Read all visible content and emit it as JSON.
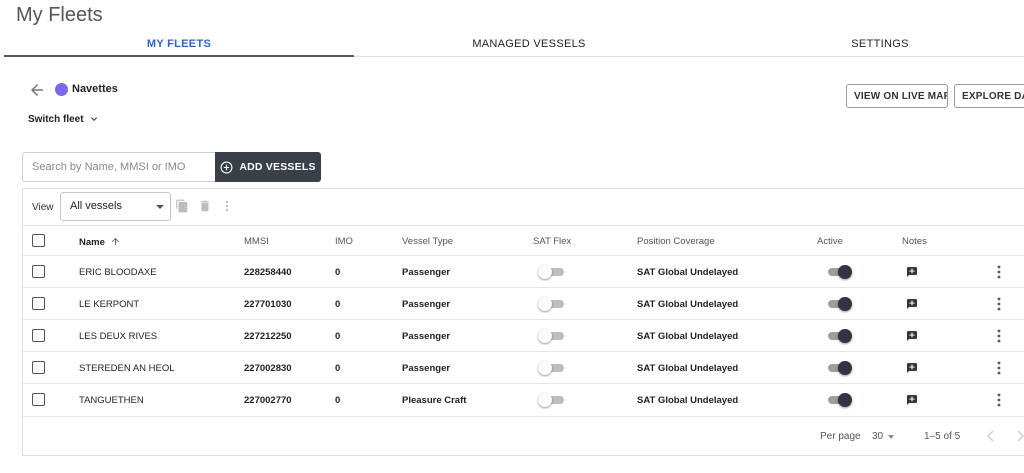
{
  "page_title": "My Fleets",
  "tabs": [
    {
      "label": "MY FLEETS",
      "active": true
    },
    {
      "label": "MANAGED VESSELS",
      "active": false
    },
    {
      "label": "SETTINGS",
      "active": false
    }
  ],
  "fleet": {
    "name": "Navettes",
    "color": "#7b68ee",
    "switch_label": "Switch fleet"
  },
  "actions": {
    "view_on_live_map": "VIEW ON LIVE MAP",
    "explore_data": "EXPLORE DATA"
  },
  "search": {
    "placeholder": "Search by Name, MMSI or IMO",
    "value": ""
  },
  "add_vessels_label": "ADD VESSELS",
  "toolbar": {
    "view_label": "View",
    "view_selected": "All vessels"
  },
  "table": {
    "columns": {
      "name": "Name",
      "mmsi": "MMSI",
      "imo": "IMO",
      "vessel_type": "Vessel Type",
      "sat_flex": "SAT Flex",
      "position_coverage": "Position Coverage",
      "active": "Active",
      "notes": "Notes"
    },
    "rows": [
      {
        "name": "ERIC BLOODAXE",
        "mmsi": "228258440",
        "imo": "0",
        "vessel_type": "Passenger",
        "sat_flex": false,
        "position_coverage": "SAT Global Undelayed",
        "active": true
      },
      {
        "name": "LE KERPONT",
        "mmsi": "227701030",
        "imo": "0",
        "vessel_type": "Passenger",
        "sat_flex": false,
        "position_coverage": "SAT Global Undelayed",
        "active": true
      },
      {
        "name": "LES DEUX RIVES",
        "mmsi": "227212250",
        "imo": "0",
        "vessel_type": "Passenger",
        "sat_flex": false,
        "position_coverage": "SAT Global Undelayed",
        "active": true
      },
      {
        "name": "STEREDEN AN HEOL",
        "mmsi": "227002830",
        "imo": "0",
        "vessel_type": "Passenger",
        "sat_flex": false,
        "position_coverage": "SAT Global Undelayed",
        "active": true
      },
      {
        "name": "TANGUETHEN",
        "mmsi": "227002770",
        "imo": "0",
        "vessel_type": "Pleasure Craft",
        "sat_flex": false,
        "position_coverage": "SAT Global Undelayed",
        "active": true
      }
    ]
  },
  "pagination": {
    "per_page_label": "Per page",
    "per_page_value": "30",
    "range": "1–5 of 5"
  },
  "icons": {
    "back": "arrow-left-icon",
    "switch": "chevron-down-icon",
    "add": "plus-circle-icon",
    "copy": "copy-icon",
    "trash": "trash-icon",
    "menu": "more-vert-icon",
    "sort": "arrow-up-icon",
    "note": "add-note-icon"
  },
  "colors": {
    "accent_tab": "#2f62c8",
    "add_button_bg": "#3a4049",
    "toggle_on_knob": "#2f3542"
  }
}
